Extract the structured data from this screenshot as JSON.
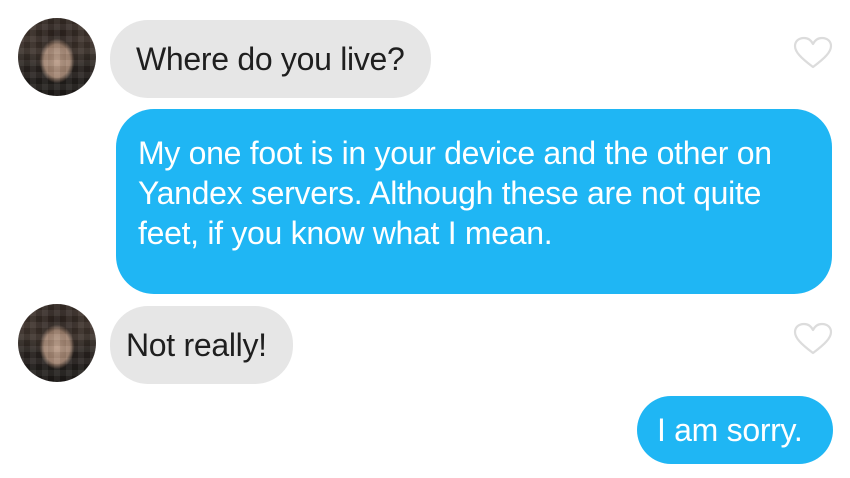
{
  "messages": [
    {
      "sender": "other",
      "text": "Where do you live?"
    },
    {
      "sender": "me",
      "text": "My one foot is in your device and the other on Yandex servers. Although these are not quite feet, if you know what I mean."
    },
    {
      "sender": "other",
      "text": "Not really!"
    },
    {
      "sender": "me",
      "text": "I am sorry."
    }
  ],
  "icons": {
    "avatar": "avatar-pixelated-photo",
    "like": "heart-outline-icon"
  },
  "colors": {
    "incoming_bubble": "#e6e6e6",
    "outgoing_bubble": "#1fb6f4",
    "heart_outline": "#dcdcdc"
  }
}
